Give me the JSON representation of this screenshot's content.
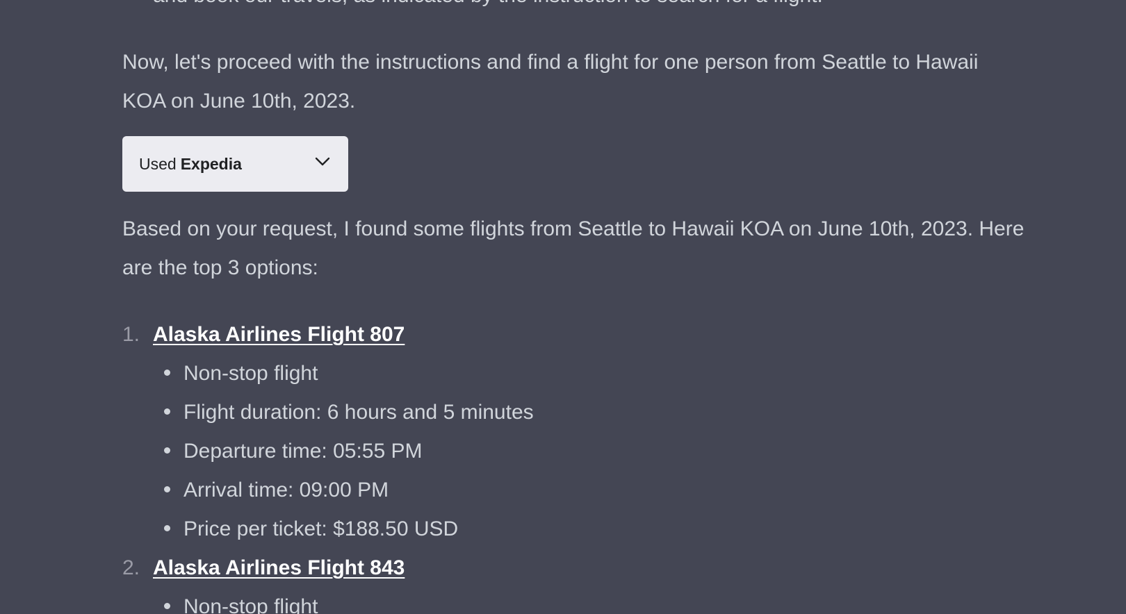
{
  "message": {
    "cut_line": "and book our travels, as indicated by the instruction to search for a flight.",
    "intro": "Now, let's proceed with the instructions and find a flight for one person from Seattle to Hawaii KOA on June 10th, 2023.",
    "plugin": {
      "used_label": "Used",
      "plugin_name": "Expedia",
      "chevron_icon": "chevron-down-icon"
    },
    "result_text": "Based on your request, I found some flights from Seattle to Hawaii KOA on June 10th, 2023. Here are the top 3 options:",
    "flights": [
      {
        "number": "1.",
        "title": "Alaska Airlines Flight 807",
        "details": [
          "Non-stop flight",
          "Flight duration: 6 hours and 5 minutes",
          "Departure time: 05:55 PM",
          "Arrival time: 09:00 PM",
          "Price per ticket: $188.50 USD"
        ]
      },
      {
        "number": "2.",
        "title": "Alaska Airlines Flight 843",
        "details": [
          "Non-stop flight"
        ]
      }
    ]
  }
}
